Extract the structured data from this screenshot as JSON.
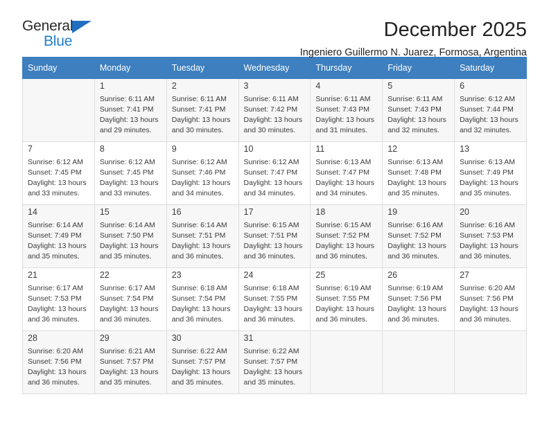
{
  "brand": {
    "name_top": "General",
    "name_bottom": "Blue",
    "triangle_color": "#1f6fc0",
    "blue_color": "#1f7ed0"
  },
  "header": {
    "title": "December 2025",
    "subtitle": "Ingeniero Guillermo N. Juarez, Formosa, Argentina"
  },
  "calendar": {
    "header_bg": "#3d7fbf",
    "weekdays": [
      "Sunday",
      "Monday",
      "Tuesday",
      "Wednesday",
      "Thursday",
      "Friday",
      "Saturday"
    ],
    "weeks": [
      [
        {
          "day": "",
          "sunrise": "",
          "sunset": "",
          "daylight_line1": "",
          "daylight_line2": ""
        },
        {
          "day": "1",
          "sunrise": "Sunrise: 6:11 AM",
          "sunset": "Sunset: 7:41 PM",
          "daylight_line1": "Daylight: 13 hours",
          "daylight_line2": "and 29 minutes."
        },
        {
          "day": "2",
          "sunrise": "Sunrise: 6:11 AM",
          "sunset": "Sunset: 7:41 PM",
          "daylight_line1": "Daylight: 13 hours",
          "daylight_line2": "and 30 minutes."
        },
        {
          "day": "3",
          "sunrise": "Sunrise: 6:11 AM",
          "sunset": "Sunset: 7:42 PM",
          "daylight_line1": "Daylight: 13 hours",
          "daylight_line2": "and 30 minutes."
        },
        {
          "day": "4",
          "sunrise": "Sunrise: 6:11 AM",
          "sunset": "Sunset: 7:43 PM",
          "daylight_line1": "Daylight: 13 hours",
          "daylight_line2": "and 31 minutes."
        },
        {
          "day": "5",
          "sunrise": "Sunrise: 6:11 AM",
          "sunset": "Sunset: 7:43 PM",
          "daylight_line1": "Daylight: 13 hours",
          "daylight_line2": "and 32 minutes."
        },
        {
          "day": "6",
          "sunrise": "Sunrise: 6:12 AM",
          "sunset": "Sunset: 7:44 PM",
          "daylight_line1": "Daylight: 13 hours",
          "daylight_line2": "and 32 minutes."
        }
      ],
      [
        {
          "day": "7",
          "sunrise": "Sunrise: 6:12 AM",
          "sunset": "Sunset: 7:45 PM",
          "daylight_line1": "Daylight: 13 hours",
          "daylight_line2": "and 33 minutes."
        },
        {
          "day": "8",
          "sunrise": "Sunrise: 6:12 AM",
          "sunset": "Sunset: 7:45 PM",
          "daylight_line1": "Daylight: 13 hours",
          "daylight_line2": "and 33 minutes."
        },
        {
          "day": "9",
          "sunrise": "Sunrise: 6:12 AM",
          "sunset": "Sunset: 7:46 PM",
          "daylight_line1": "Daylight: 13 hours",
          "daylight_line2": "and 34 minutes."
        },
        {
          "day": "10",
          "sunrise": "Sunrise: 6:12 AM",
          "sunset": "Sunset: 7:47 PM",
          "daylight_line1": "Daylight: 13 hours",
          "daylight_line2": "and 34 minutes."
        },
        {
          "day": "11",
          "sunrise": "Sunrise: 6:13 AM",
          "sunset": "Sunset: 7:47 PM",
          "daylight_line1": "Daylight: 13 hours",
          "daylight_line2": "and 34 minutes."
        },
        {
          "day": "12",
          "sunrise": "Sunrise: 6:13 AM",
          "sunset": "Sunset: 7:48 PM",
          "daylight_line1": "Daylight: 13 hours",
          "daylight_line2": "and 35 minutes."
        },
        {
          "day": "13",
          "sunrise": "Sunrise: 6:13 AM",
          "sunset": "Sunset: 7:49 PM",
          "daylight_line1": "Daylight: 13 hours",
          "daylight_line2": "and 35 minutes."
        }
      ],
      [
        {
          "day": "14",
          "sunrise": "Sunrise: 6:14 AM",
          "sunset": "Sunset: 7:49 PM",
          "daylight_line1": "Daylight: 13 hours",
          "daylight_line2": "and 35 minutes."
        },
        {
          "day": "15",
          "sunrise": "Sunrise: 6:14 AM",
          "sunset": "Sunset: 7:50 PM",
          "daylight_line1": "Daylight: 13 hours",
          "daylight_line2": "and 35 minutes."
        },
        {
          "day": "16",
          "sunrise": "Sunrise: 6:14 AM",
          "sunset": "Sunset: 7:51 PM",
          "daylight_line1": "Daylight: 13 hours",
          "daylight_line2": "and 36 minutes."
        },
        {
          "day": "17",
          "sunrise": "Sunrise: 6:15 AM",
          "sunset": "Sunset: 7:51 PM",
          "daylight_line1": "Daylight: 13 hours",
          "daylight_line2": "and 36 minutes."
        },
        {
          "day": "18",
          "sunrise": "Sunrise: 6:15 AM",
          "sunset": "Sunset: 7:52 PM",
          "daylight_line1": "Daylight: 13 hours",
          "daylight_line2": "and 36 minutes."
        },
        {
          "day": "19",
          "sunrise": "Sunrise: 6:16 AM",
          "sunset": "Sunset: 7:52 PM",
          "daylight_line1": "Daylight: 13 hours",
          "daylight_line2": "and 36 minutes."
        },
        {
          "day": "20",
          "sunrise": "Sunrise: 6:16 AM",
          "sunset": "Sunset: 7:53 PM",
          "daylight_line1": "Daylight: 13 hours",
          "daylight_line2": "and 36 minutes."
        }
      ],
      [
        {
          "day": "21",
          "sunrise": "Sunrise: 6:17 AM",
          "sunset": "Sunset: 7:53 PM",
          "daylight_line1": "Daylight: 13 hours",
          "daylight_line2": "and 36 minutes."
        },
        {
          "day": "22",
          "sunrise": "Sunrise: 6:17 AM",
          "sunset": "Sunset: 7:54 PM",
          "daylight_line1": "Daylight: 13 hours",
          "daylight_line2": "and 36 minutes."
        },
        {
          "day": "23",
          "sunrise": "Sunrise: 6:18 AM",
          "sunset": "Sunset: 7:54 PM",
          "daylight_line1": "Daylight: 13 hours",
          "daylight_line2": "and 36 minutes."
        },
        {
          "day": "24",
          "sunrise": "Sunrise: 6:18 AM",
          "sunset": "Sunset: 7:55 PM",
          "daylight_line1": "Daylight: 13 hours",
          "daylight_line2": "and 36 minutes."
        },
        {
          "day": "25",
          "sunrise": "Sunrise: 6:19 AM",
          "sunset": "Sunset: 7:55 PM",
          "daylight_line1": "Daylight: 13 hours",
          "daylight_line2": "and 36 minutes."
        },
        {
          "day": "26",
          "sunrise": "Sunrise: 6:19 AM",
          "sunset": "Sunset: 7:56 PM",
          "daylight_line1": "Daylight: 13 hours",
          "daylight_line2": "and 36 minutes."
        },
        {
          "day": "27",
          "sunrise": "Sunrise: 6:20 AM",
          "sunset": "Sunset: 7:56 PM",
          "daylight_line1": "Daylight: 13 hours",
          "daylight_line2": "and 36 minutes."
        }
      ],
      [
        {
          "day": "28",
          "sunrise": "Sunrise: 6:20 AM",
          "sunset": "Sunset: 7:56 PM",
          "daylight_line1": "Daylight: 13 hours",
          "daylight_line2": "and 36 minutes."
        },
        {
          "day": "29",
          "sunrise": "Sunrise: 6:21 AM",
          "sunset": "Sunset: 7:57 PM",
          "daylight_line1": "Daylight: 13 hours",
          "daylight_line2": "and 35 minutes."
        },
        {
          "day": "30",
          "sunrise": "Sunrise: 6:22 AM",
          "sunset": "Sunset: 7:57 PM",
          "daylight_line1": "Daylight: 13 hours",
          "daylight_line2": "and 35 minutes."
        },
        {
          "day": "31",
          "sunrise": "Sunrise: 6:22 AM",
          "sunset": "Sunset: 7:57 PM",
          "daylight_line1": "Daylight: 13 hours",
          "daylight_line2": "and 35 minutes."
        },
        {
          "day": "",
          "sunrise": "",
          "sunset": "",
          "daylight_line1": "",
          "daylight_line2": ""
        },
        {
          "day": "",
          "sunrise": "",
          "sunset": "",
          "daylight_line1": "",
          "daylight_line2": ""
        },
        {
          "day": "",
          "sunrise": "",
          "sunset": "",
          "daylight_line1": "",
          "daylight_line2": ""
        }
      ]
    ]
  }
}
